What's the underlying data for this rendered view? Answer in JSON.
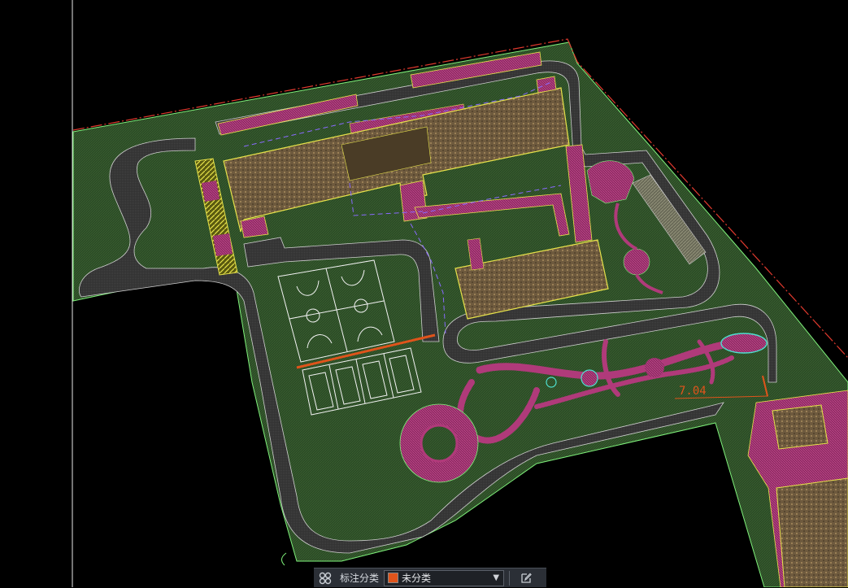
{
  "canvas": {
    "background": "#000000",
    "dimension_text": "7.04"
  },
  "colors": {
    "hatch_green": "#2c4a26",
    "hatch_magenta": "#b03a7a",
    "hatch_brown": "#8a7250",
    "road_gray": "#3b3b3b",
    "line_yellow": "#e6e24a",
    "line_green": "#7ef07a",
    "line_red": "#e23a2e",
    "court_white": "#f2f2f2",
    "accent_orange": "#e0541b"
  },
  "bottom_toolbar": {
    "grid_icon": "grid-icon",
    "label": "标注分类",
    "category_select": {
      "selected": "未分类",
      "swatch_color": "#e0541b"
    },
    "edit_icon": "edit-icon"
  }
}
